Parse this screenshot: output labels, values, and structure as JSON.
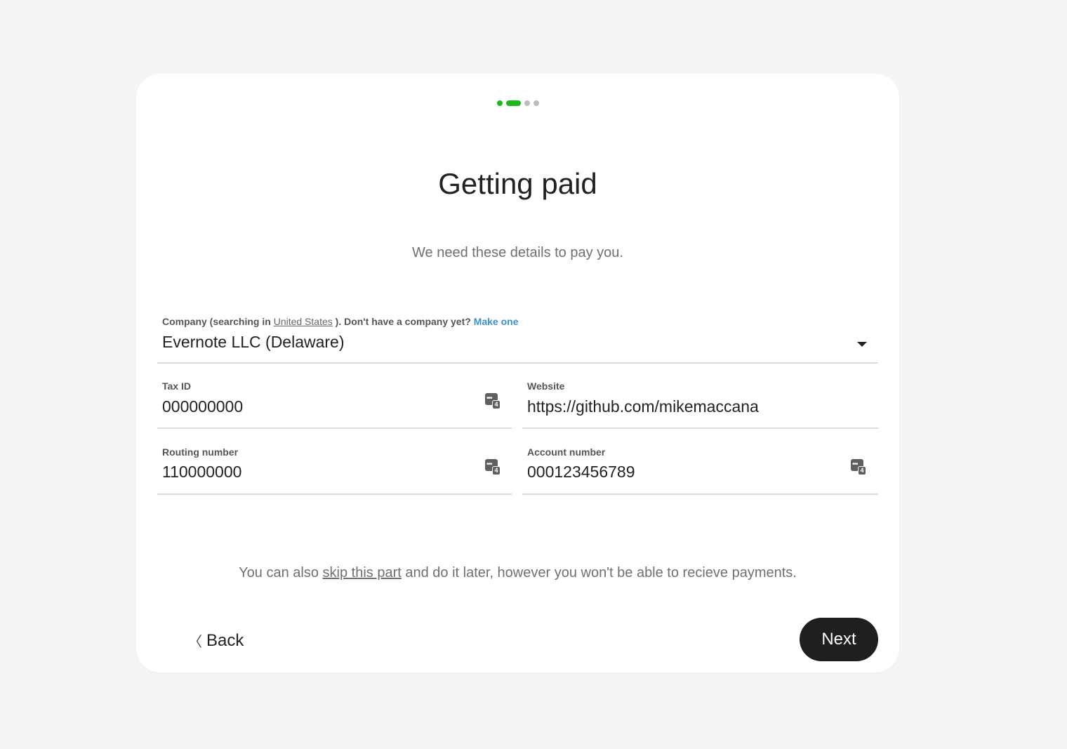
{
  "stepper": {
    "steps": 4,
    "current": 2
  },
  "header": {
    "title": "Getting paid",
    "subtitle": "We need these details to pay you."
  },
  "company": {
    "label_prefix": "Company (searching in",
    "country": "United States",
    "label_middle": "). Don't have a company yet?",
    "make_one": "Make one",
    "value": "Evernote LLC (Delaware)"
  },
  "tax_id": {
    "label": "Tax ID",
    "value": "000000000"
  },
  "website": {
    "label": "Website",
    "value": "https://github.com/mikemaccana"
  },
  "routing": {
    "label": "Routing number",
    "value": "110000000"
  },
  "account": {
    "label": "Account number",
    "value": "000123456789"
  },
  "password_icon": {
    "name": "password-manager-icon",
    "badge": "4"
  },
  "note": {
    "before": "You can also",
    "link": "skip this part",
    "after": "and do it later, however you won't be able to recieve payments."
  },
  "buttons": {
    "back_chevron": "〈",
    "back": "Back",
    "next": "Next"
  },
  "colors": {
    "accent": "#1cb81c",
    "link": "#3b8fd6",
    "primary_button": "#1f1f1f"
  }
}
